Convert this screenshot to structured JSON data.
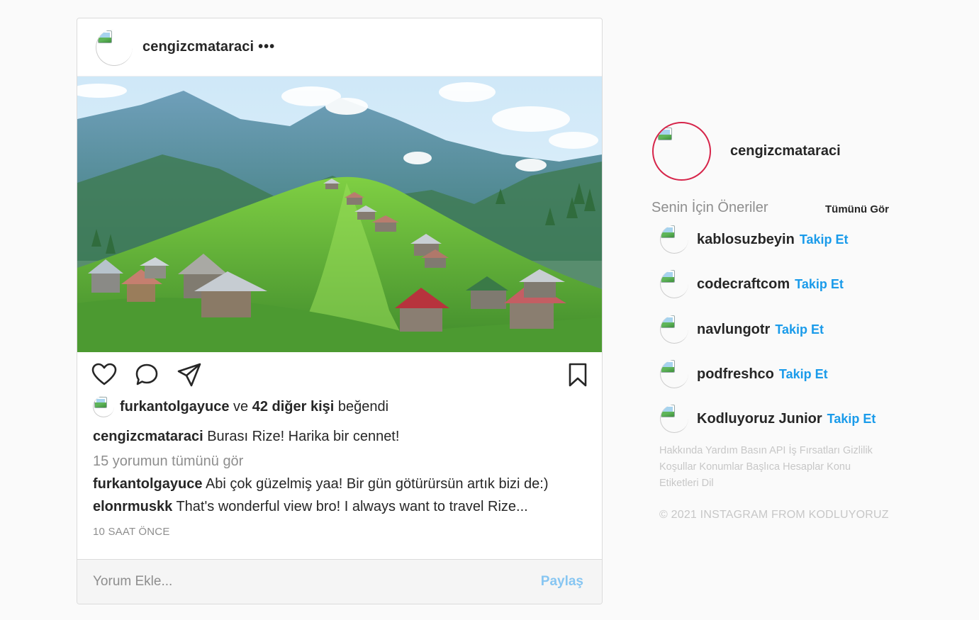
{
  "post": {
    "username": "cengizcmataraci",
    "more": "•••",
    "likes": {
      "liker": "furkantolgayuce",
      "connector": "ve",
      "others": "42 diğer kişi",
      "suffix": "beğendi"
    },
    "caption": {
      "username": "cengizcmataraci",
      "text": "Burası Rize! Harika bir cennet!"
    },
    "view_all_comments": "15 yorumun tümünü gör",
    "comments": [
      {
        "username": "furkantolgayuce",
        "text": "Abi çok güzelmiş yaa! Bir gün götürürsün artık bizi de:)"
      },
      {
        "username": "elonrmuskk",
        "text": "That's wonderful view bro! I always want to travel Rize..."
      }
    ],
    "time": "10 SAAT ÖNCE",
    "comment_placeholder": "Yorum Ekle...",
    "share_label": "Paylaş"
  },
  "sidebar": {
    "profile_username": "cengizcmataraci",
    "suggestions_title": "Senin İçin Öneriler",
    "see_all": "Tümünü Gör",
    "follow_label": "Takip Et",
    "suggestions": [
      {
        "username": "kablosuzbeyin"
      },
      {
        "username": "codecraftcom"
      },
      {
        "username": "navlungotr"
      },
      {
        "username": "podfreshco"
      },
      {
        "username": "Kodluyoruz Junior"
      }
    ],
    "footer_links": [
      "Hakkında",
      "Yardım",
      "Basın",
      "API",
      "İş Fırsatları",
      "Gizlilik",
      "Koşullar",
      "Konumlar",
      "Başlıca Hesaplar",
      "Konu Etiketleri",
      "Dil"
    ],
    "copyright": "© 2021 INSTAGRAM FROM KODLUYORUZ"
  },
  "colors": {
    "accent_blue": "#1a9bea",
    "share_blue_disabled": "#87c6f2",
    "story_ring": "#d6254a",
    "muted_text": "#8e8e8e"
  }
}
